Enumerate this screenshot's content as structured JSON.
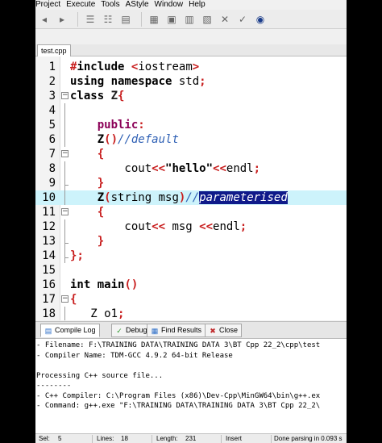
{
  "menu": [
    "Project",
    "Execute",
    "Tools",
    "AStyle",
    "Window",
    "Help"
  ],
  "file_tab": "test.cpp",
  "code": [
    {
      "n": "1",
      "fold": "",
      "parts": [
        [
          "op",
          "#"
        ],
        [
          "kw",
          "include"
        ],
        [
          "id",
          " "
        ],
        [
          "op",
          "<"
        ],
        [
          "id",
          "iostream"
        ],
        [
          "op",
          ">"
        ]
      ]
    },
    {
      "n": "2",
      "fold": "",
      "parts": [
        [
          "kw",
          "using namespace "
        ],
        [
          "id",
          "std"
        ],
        [
          "op",
          ";"
        ]
      ]
    },
    {
      "n": "3",
      "fold": "minus",
      "parts": [
        [
          "kw",
          "class "
        ],
        [
          "cls",
          "Z"
        ],
        [
          "br",
          "{"
        ]
      ]
    },
    {
      "n": "4",
      "fold": "line",
      "parts": []
    },
    {
      "n": "5",
      "fold": "line",
      "parts": [
        [
          "id",
          "    "
        ],
        [
          "pu",
          "public"
        ],
        [
          "op",
          ":"
        ]
      ]
    },
    {
      "n": "6",
      "fold": "line",
      "parts": [
        [
          "id",
          "    "
        ],
        [
          "fn",
          "Z"
        ],
        [
          "br",
          "()"
        ],
        [
          "cm",
          "//default"
        ]
      ]
    },
    {
      "n": "7",
      "fold": "minus",
      "parts": [
        [
          "id",
          "    "
        ],
        [
          "br",
          "{"
        ]
      ]
    },
    {
      "n": "8",
      "fold": "line",
      "parts": [
        [
          "id",
          "        cout"
        ],
        [
          "op",
          "<<"
        ],
        [
          "str",
          "\"hello\""
        ],
        [
          "op",
          "<<"
        ],
        [
          "id",
          "endl"
        ],
        [
          "op",
          ";"
        ]
      ]
    },
    {
      "n": "9",
      "fold": "end",
      "parts": [
        [
          "id",
          "    "
        ],
        [
          "br",
          "}"
        ]
      ]
    },
    {
      "n": "10",
      "fold": "line",
      "parts": [
        [
          "id",
          "    "
        ],
        [
          "fn",
          "Z"
        ],
        [
          "br",
          "("
        ],
        [
          "id",
          "string msg"
        ],
        [
          "br",
          ")"
        ],
        [
          "cm",
          "//"
        ],
        [
          "sel",
          "parameterised"
        ]
      ],
      "highlight": true
    },
    {
      "n": "11",
      "fold": "minus",
      "parts": [
        [
          "id",
          "    "
        ],
        [
          "br",
          "{"
        ]
      ]
    },
    {
      "n": "12",
      "fold": "line",
      "parts": [
        [
          "id",
          "        cout"
        ],
        [
          "op",
          "<<"
        ],
        [
          "id",
          " msg "
        ],
        [
          "op",
          "<<"
        ],
        [
          "id",
          "endl"
        ],
        [
          "op",
          ";"
        ]
      ]
    },
    {
      "n": "13",
      "fold": "end",
      "parts": [
        [
          "id",
          "    "
        ],
        [
          "br",
          "}"
        ]
      ]
    },
    {
      "n": "14",
      "fold": "end",
      "parts": [
        [
          "br",
          "}"
        ],
        [
          "op",
          ";"
        ]
      ]
    },
    {
      "n": "15",
      "fold": "",
      "parts": []
    },
    {
      "n": "16",
      "fold": "",
      "parts": [
        [
          "kw",
          "int "
        ],
        [
          "fn",
          "main"
        ],
        [
          "br",
          "()"
        ]
      ]
    },
    {
      "n": "17",
      "fold": "minus",
      "parts": [
        [
          "br",
          "{"
        ]
      ]
    },
    {
      "n": "18",
      "fold": "line",
      "parts": [
        [
          "id",
          "   Z o1"
        ],
        [
          "op",
          ";"
        ]
      ]
    }
  ],
  "bottom_tabs": [
    {
      "label": "Compile Log",
      "icon": "compile-log-icon",
      "active": true
    },
    {
      "label": "Debug",
      "icon": "debug-icon",
      "active": false
    },
    {
      "label": "Find Results",
      "icon": "find-results-icon",
      "active": false
    },
    {
      "label": "Close",
      "icon": "close-icon",
      "active": false
    }
  ],
  "log_lines": [
    "- Filename: F:\\TRAINING DATA\\TRAINING DATA 3\\BT Cpp 22_2\\cpp\\test",
    "- Compiler Name: TDM-GCC 4.9.2 64-bit Release",
    "",
    "Processing C++ source file...",
    "--------",
    "- C++ Compiler: C:\\Program Files (x86)\\Dev-Cpp\\MinGW64\\bin\\g++.ex",
    "- Command: g++.exe \"F:\\TRAINING DATA\\TRAINING DATA 3\\BT Cpp 22_2\\"
  ],
  "status": {
    "sel_label": "Sel:",
    "sel": "5",
    "lines_label": "Lines:",
    "lines": "18",
    "length_label": "Length:",
    "length": "231",
    "mode": "Insert",
    "message": "Done parsing in 0.093 s"
  }
}
